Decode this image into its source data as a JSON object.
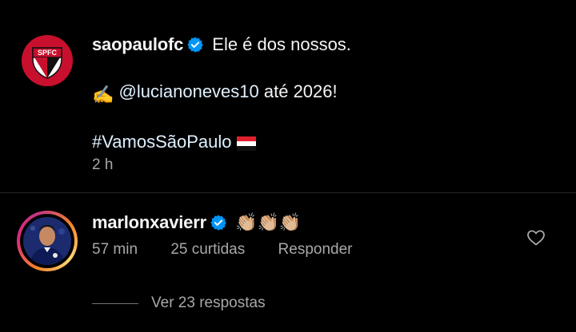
{
  "caption": {
    "username": "saopaulofc",
    "avatar_badge_text": "SPFC",
    "line1": "Ele é dos nossos.",
    "line2_emoji": "✍️",
    "line2_mention": "@lucianoneves10",
    "line2_rest": " até 2026!",
    "line3_hashtag": "#VamosSãoPaulo",
    "line3_flag": "flag-icon",
    "time": "2 h"
  },
  "comment": {
    "username": "marlonxavierr",
    "text_emoji": "👏🏼👏🏼👏🏼",
    "time": "57 min",
    "likes": "25 curtidas",
    "reply_label": "Responder",
    "view_replies_label": "Ver 23 respostas"
  },
  "colors": {
    "background": "#000000",
    "text": "#f5f5f5",
    "secondary_text": "#a8a8a8",
    "verified_blue": "#0095f6",
    "club_red": "#c8102e",
    "divider": "#262626"
  },
  "icons": [
    "verified-icon",
    "heart-icon",
    "flag-icon",
    "club-crest-icon"
  ]
}
